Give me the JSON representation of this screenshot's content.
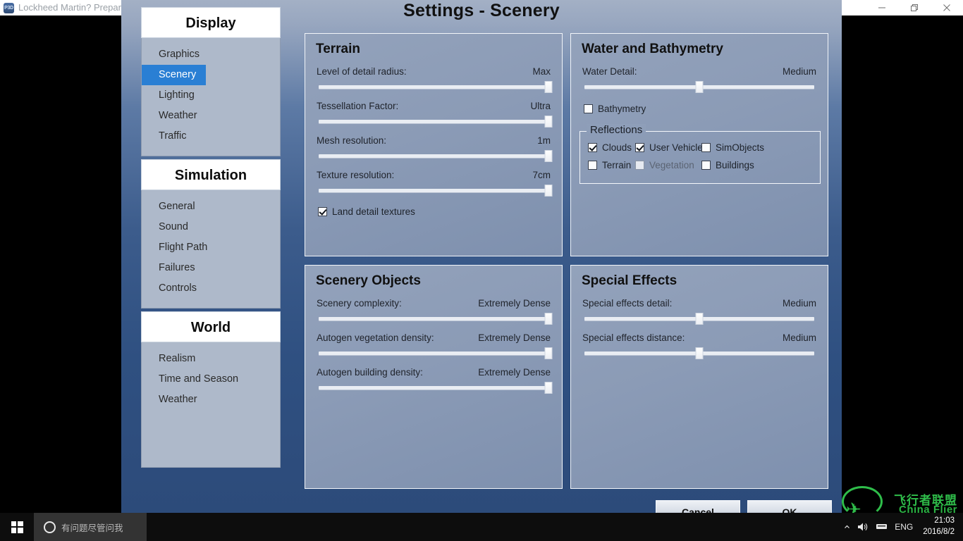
{
  "background_window": {
    "title": "Lockheed Martin? Prepar",
    "icon": "p3d-app-icon",
    "controls": [
      {
        "name": "minimize",
        "glyph": "minimize-icon"
      },
      {
        "name": "restore",
        "glyph": "restore-icon"
      },
      {
        "name": "close",
        "glyph": "close-icon"
      }
    ]
  },
  "dialog": {
    "title": "Settings - Scenery",
    "buttons": {
      "cancel": "Cancel",
      "ok": "OK"
    }
  },
  "sidebar": {
    "groups": [
      {
        "header": "Display",
        "items": [
          {
            "label": "Graphics",
            "active": false
          },
          {
            "label": "Scenery",
            "active": true
          },
          {
            "label": "Lighting",
            "active": false
          },
          {
            "label": "Weather",
            "active": false
          },
          {
            "label": "Traffic",
            "active": false
          }
        ]
      },
      {
        "header": "Simulation",
        "items": [
          {
            "label": "General",
            "active": false
          },
          {
            "label": "Sound",
            "active": false
          },
          {
            "label": "Flight Path",
            "active": false
          },
          {
            "label": "Failures",
            "active": false
          },
          {
            "label": "Controls",
            "active": false
          }
        ]
      },
      {
        "header": "World",
        "items": [
          {
            "label": "Realism",
            "active": false
          },
          {
            "label": "Time and Season",
            "active": false
          },
          {
            "label": "Weather",
            "active": false
          }
        ]
      }
    ]
  },
  "panels": {
    "terrain": {
      "title": "Terrain",
      "sliders": [
        {
          "label": "Level of detail radius:",
          "value": "Max",
          "percent": 100
        },
        {
          "label": "Tessellation Factor:",
          "value": "Ultra",
          "percent": 100
        },
        {
          "label": "Mesh resolution:",
          "value": "1m",
          "percent": 100
        },
        {
          "label": "Texture resolution:",
          "value": "7cm",
          "percent": 100
        }
      ],
      "checkbox": {
        "label": "Land detail textures",
        "checked": true
      }
    },
    "water": {
      "title": "Water and Bathymetry",
      "sliders": [
        {
          "label": "Water Detail:",
          "value": "Medium",
          "percent": 50
        }
      ],
      "bathymetry": {
        "label": "Bathymetry",
        "checked": false
      },
      "reflections": {
        "legend": "Reflections",
        "items": [
          {
            "label": "Clouds",
            "checked": true,
            "disabled": false
          },
          {
            "label": "User Vehicle",
            "checked": true,
            "disabled": false
          },
          {
            "label": "SimObjects",
            "checked": false,
            "disabled": false
          },
          {
            "label": "Terrain",
            "checked": false,
            "disabled": false
          },
          {
            "label": "Vegetation",
            "checked": false,
            "disabled": true
          },
          {
            "label": "Buildings",
            "checked": false,
            "disabled": false
          }
        ]
      }
    },
    "scenery_objects": {
      "title": "Scenery Objects",
      "sliders": [
        {
          "label": "Scenery complexity:",
          "value": "Extremely Dense",
          "percent": 100
        },
        {
          "label": "Autogen vegetation density:",
          "value": "Extremely Dense",
          "percent": 100
        },
        {
          "label": "Autogen building density:",
          "value": "Extremely Dense",
          "percent": 100
        }
      ]
    },
    "special_effects": {
      "title": "Special Effects",
      "sliders": [
        {
          "label": "Special effects detail:",
          "value": "Medium",
          "percent": 50
        },
        {
          "label": "Special effects distance:",
          "value": "Medium",
          "percent": 50
        }
      ]
    }
  },
  "taskbar": {
    "start": "start-button",
    "search_placeholder": "有问题尽管问我",
    "tray": {
      "overflow": "show-hidden-icons",
      "volume": "speaker-icon",
      "network": "network-icon",
      "language": "ENG",
      "time": "21:03",
      "date": "2016/8/2"
    }
  },
  "watermark": {
    "chinese": "飞行者联盟",
    "english": "China Flier"
  },
  "colors": {
    "accent": "#2a7fd4",
    "panel": "#8b9bb6",
    "dialog_top": "#97a6bf",
    "watermark_green": "#2fbd4a"
  }
}
